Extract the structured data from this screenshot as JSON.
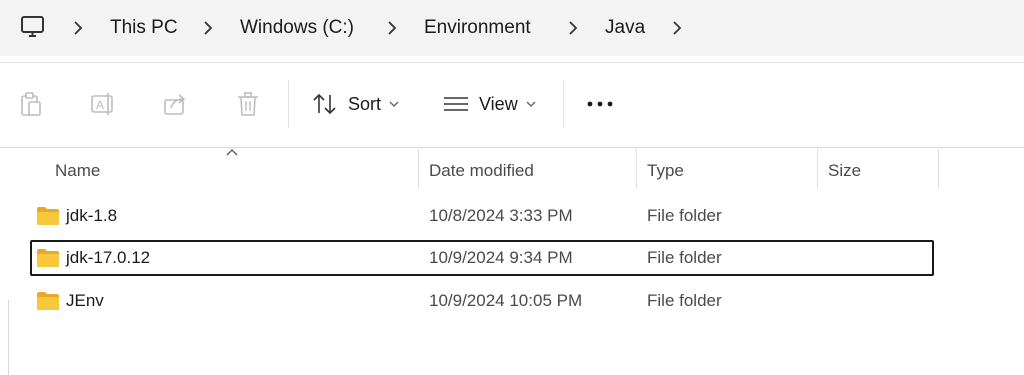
{
  "breadcrumb": {
    "items": [
      "This PC",
      "Windows (C:)",
      "Environment",
      "Java"
    ]
  },
  "toolbar": {
    "sort_label": "Sort",
    "view_label": "View",
    "icons": [
      "paste-icon",
      "rename-icon",
      "share-icon",
      "delete-icon"
    ]
  },
  "columns": {
    "name": "Name",
    "date_modified": "Date modified",
    "type": "Type",
    "size": "Size",
    "sorted_by": "name"
  },
  "files": [
    {
      "name": "jdk-1.8",
      "date": "10/8/2024 3:33 PM",
      "type": "File folder",
      "size": "",
      "selected": false
    },
    {
      "name": "jdk-17.0.12",
      "date": "10/9/2024 9:34 PM",
      "type": "File folder",
      "size": "",
      "selected": true
    },
    {
      "name": "JEnv",
      "date": "10/9/2024 10:05 PM",
      "type": "File folder",
      "size": "",
      "selected": false
    }
  ],
  "colors": {
    "folder": "#f8c83a",
    "folder_dark": "#e9a825",
    "addressbar_bg": "#f3f3f3"
  }
}
